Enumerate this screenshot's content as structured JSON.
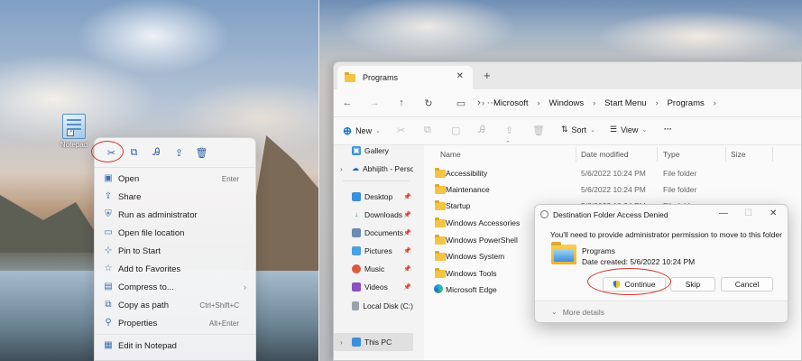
{
  "desktop": {
    "icon_label": "Notepad"
  },
  "context_menu": {
    "icon_row": [
      "cut-icon",
      "copy-icon",
      "rename-icon",
      "share-icon",
      "delete-icon"
    ],
    "items": [
      {
        "label": "Open",
        "shortcut": "Enter",
        "icon": "open-icon"
      },
      {
        "label": "Share",
        "shortcut": "",
        "icon": "share-icon"
      },
      {
        "label": "Run as administrator",
        "shortcut": "",
        "icon": "shield-icon"
      },
      {
        "label": "Open file location",
        "shortcut": "",
        "icon": "folder-icon"
      },
      {
        "label": "Pin to Start",
        "shortcut": "",
        "icon": "pin-icon"
      },
      {
        "label": "Add to Favorites",
        "shortcut": "",
        "icon": "star-icon"
      },
      {
        "label": "Compress to...",
        "shortcut": "",
        "icon": "zip-icon"
      },
      {
        "label": "Copy as path",
        "shortcut": "Ctrl+Shift+C",
        "icon": "copy-path-icon"
      },
      {
        "label": "Properties",
        "shortcut": "Alt+Enter",
        "icon": "wrench-icon"
      },
      {
        "label": "Edit in Notepad",
        "shortcut": "",
        "icon": "notepad-icon"
      }
    ]
  },
  "explorer": {
    "tab_title": "Programs",
    "breadcrumb": [
      "Microsoft",
      "Windows",
      "Start Menu",
      "Programs"
    ],
    "toolbar": {
      "new_label": "New",
      "sort_label": "Sort",
      "view_label": "View",
      "more_label": "···"
    },
    "nav": [
      {
        "label": "Gallery"
      },
      {
        "label": "Abhijith - Persor"
      },
      {
        "label": "Desktop"
      },
      {
        "label": "Downloads"
      },
      {
        "label": "Documents"
      },
      {
        "label": "Pictures"
      },
      {
        "label": "Music"
      },
      {
        "label": "Videos"
      },
      {
        "label": "Local Disk (C:)"
      },
      {
        "label": "This PC"
      }
    ],
    "columns": {
      "name": "Name",
      "date": "Date modified",
      "type": "Type",
      "size": "Size"
    },
    "rows": [
      {
        "name": "Accessibility",
        "date": "5/6/2022 10:24 PM",
        "type": "File folder"
      },
      {
        "name": "Maintenance",
        "date": "5/6/2022 10:24 PM",
        "type": "File folder"
      },
      {
        "name": "Startup",
        "date": "5/6/2022 10:24 PM",
        "type": "File folder"
      },
      {
        "name": "Windows Accessories",
        "date": "",
        "type": ""
      },
      {
        "name": "Windows PowerShell",
        "date": "",
        "type": ""
      },
      {
        "name": "Windows System",
        "date": "",
        "type": ""
      },
      {
        "name": "Windows Tools",
        "date": "",
        "type": ""
      },
      {
        "name": "Microsoft Edge",
        "date": "",
        "type": ""
      }
    ]
  },
  "dialog": {
    "title": "Destination Folder Access Denied",
    "message": "You'll need to provide administrator permission to move to this folder",
    "folder_name": "Programs",
    "date_created": "Date created: 5/6/2022 10:24 PM",
    "continue_label": "Continue",
    "skip_label": "Skip",
    "cancel_label": "Cancel",
    "more_details": "More details"
  }
}
